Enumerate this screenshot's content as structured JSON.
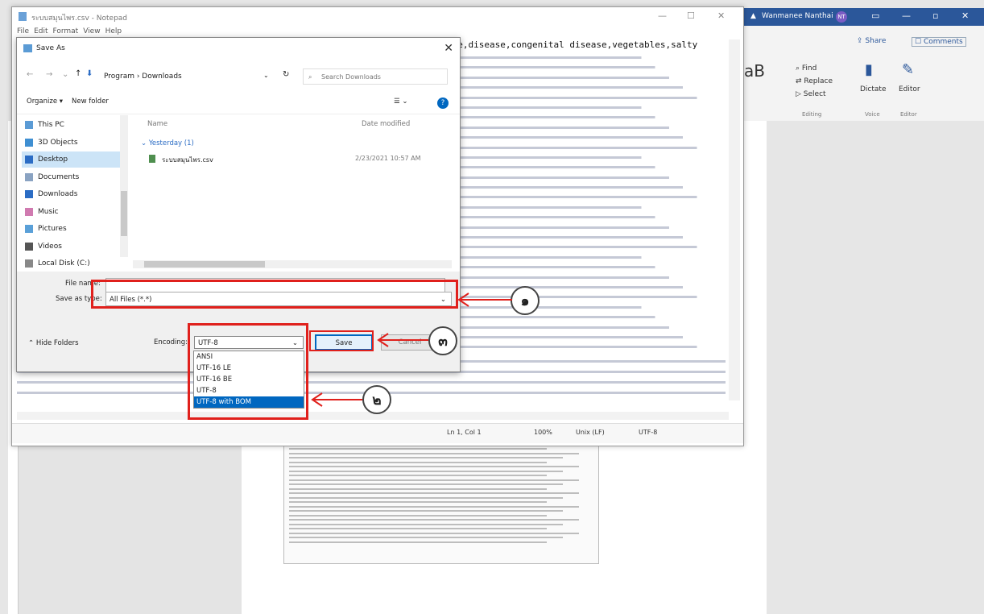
{
  "word": {
    "user_name": "Wanmanee Nanthai",
    "user_initials": "NT",
    "share": "Share",
    "comments": "Comments",
    "find": "Find",
    "replace": "Replace",
    "select": "Select",
    "editing": "Editing",
    "dictate": "Dictate",
    "voice": "Voice",
    "editor": "Editor",
    "editor_group": "Editor",
    "styles_sample": "aB"
  },
  "notepad": {
    "title": "ระบบสมุนไพร.csv - Notepad",
    "menu": [
      "File",
      "Edit",
      "Format",
      "View",
      "Help"
    ],
    "header_line": "ine,disease,congenital disease,vegetables,salty",
    "status": {
      "position": "Ln 1, Col 1",
      "zoom": "100%",
      "eol": "Unix (LF)",
      "encoding": "UTF-8"
    }
  },
  "dialog": {
    "title": "Save As",
    "path": "Program  ›  Downloads",
    "search_placeholder": "Search Downloads",
    "organize": "Organize ▾",
    "new_folder": "New folder",
    "col_name": "Name",
    "col_date": "Date modified",
    "group": "Yesterday (1)",
    "file": {
      "name": "ระบบสมุนไพร.csv",
      "date": "2/23/2021 10:57 AM"
    },
    "sidebar": [
      "This PC",
      "3D Objects",
      "Desktop",
      "Documents",
      "Downloads",
      "Music",
      "Pictures",
      "Videos",
      "Local Disk (C:)"
    ],
    "file_name_label": "File name:",
    "save_type_label": "Save as type:",
    "save_type_value": "All Files (*.*)",
    "hide_folders": "Hide Folders",
    "encoding_label": "Encoding:",
    "encoding_value": "UTF-8",
    "save": "Save",
    "cancel": "Cancel",
    "encoding_options": [
      "ANSI",
      "UTF-16 LE",
      "UTF-16 BE",
      "UTF-8",
      "UTF-8 with BOM"
    ],
    "selected_option": "UTF-8 with BOM"
  },
  "annotations": {
    "one": "๑",
    "two": "๒",
    "three": "๓"
  },
  "colors": {
    "highlight": "#e0201c",
    "accent": "#0067c0",
    "word_blue": "#2b579a"
  }
}
